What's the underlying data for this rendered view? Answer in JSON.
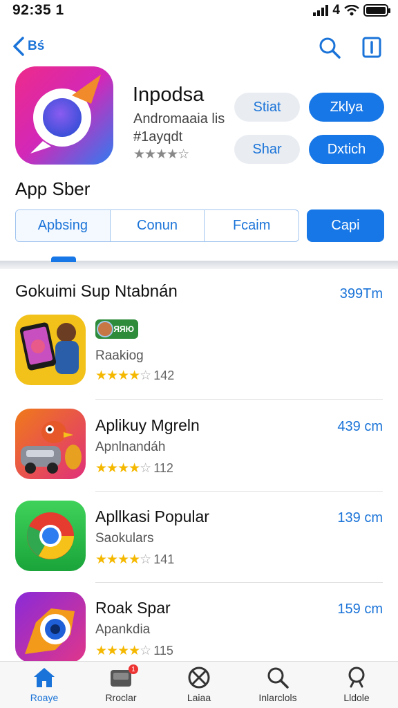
{
  "status_bar": {
    "time": "92:35 1",
    "signal_text": "4"
  },
  "nav": {
    "back_label": "Bś"
  },
  "app": {
    "name": "Inpodsa",
    "subtitle": "Andromaaia lis",
    "category": "#1ayqdt",
    "rating_stars": 3.5,
    "stars_text": "★★★★☆"
  },
  "action_buttons": [
    {
      "label": "Stiat",
      "style": "light"
    },
    {
      "label": "Zklya",
      "style": "solid"
    },
    {
      "label": "Shar",
      "style": "light"
    },
    {
      "label": "Dxtich",
      "style": "solid"
    }
  ],
  "section_header": "App Sber",
  "segments": [
    {
      "label": "Apbsing",
      "active": true
    },
    {
      "label": "Conun",
      "active": false
    },
    {
      "label": "Fcaim",
      "active": false
    }
  ],
  "segment_primary": "Capi",
  "list": {
    "title": "Gokuimi Sup Ntabnán",
    "size_header": "399Tm",
    "items": [
      {
        "title": "",
        "subtitle": "Raakiog",
        "stars_on": "★★★★",
        "stars_off": "☆",
        "count": "142",
        "size": "",
        "badge_text": "ЯЯЮ"
      },
      {
        "title": "Aplikuy Mgreln",
        "subtitle": "Apnlnandáh",
        "stars_on": "★★★★",
        "stars_off": "☆",
        "count": "112",
        "size": "439 cm",
        "badge_text": ""
      },
      {
        "title": "Apllkasi Popular",
        "subtitle": "Saokulars",
        "stars_on": "★★★★",
        "stars_off": "☆",
        "count": "141",
        "size": "139 cm",
        "badge_text": ""
      },
      {
        "title": "Roak Spar",
        "subtitle": "Apankdia",
        "stars_on": "★★★★",
        "stars_off": "☆",
        "count": "115",
        "size": "159 cm",
        "badge_text": ""
      }
    ]
  },
  "tab_bar": [
    {
      "label": "Roaye",
      "icon": "home-icon",
      "active": true
    },
    {
      "label": "Rroclar",
      "icon": "inbox-icon",
      "active": false,
      "badge": "1"
    },
    {
      "label": "Laiaa",
      "icon": "cancel-circle-icon",
      "active": false
    },
    {
      "label": "Inlarclols",
      "icon": "search-icon",
      "active": false
    },
    {
      "label": "Lldole",
      "icon": "search-alt-icon",
      "active": false
    }
  ],
  "colors": {
    "accent": "#1877e6",
    "star": "#f5b800",
    "light_button": "#e9edf2"
  }
}
